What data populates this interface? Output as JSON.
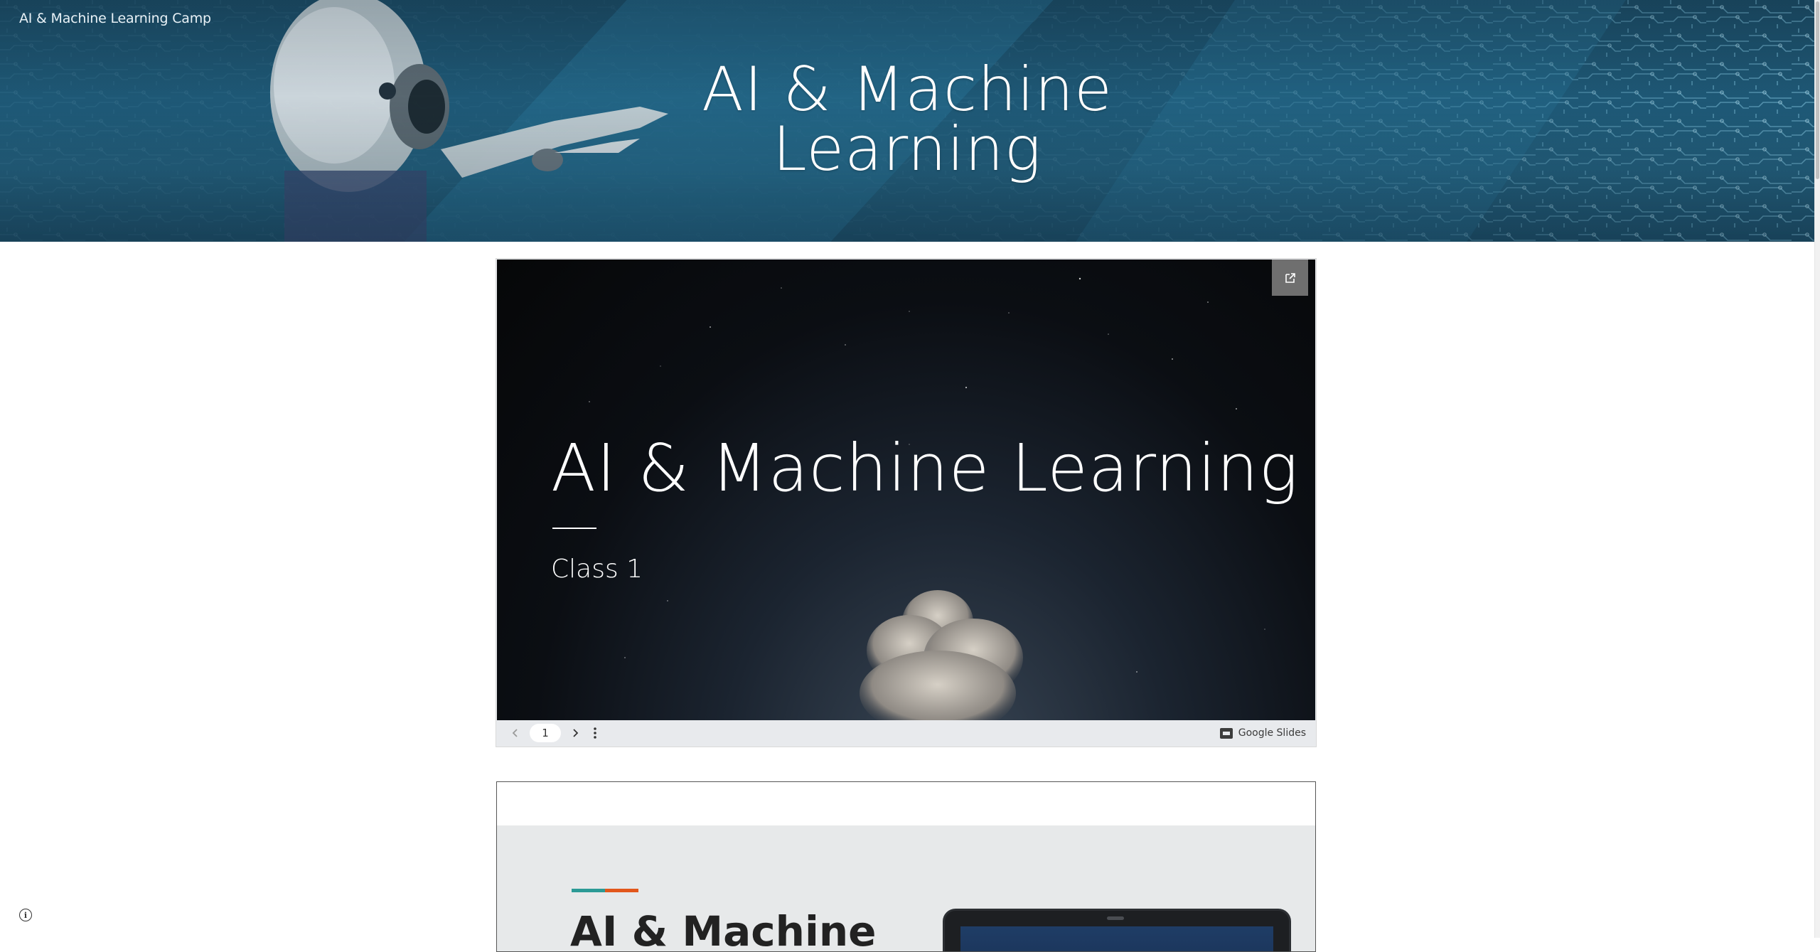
{
  "site": {
    "name": "AI & Machine Learning Camp"
  },
  "banner": {
    "title_line1": "AI & Machine",
    "title_line2": "Learning"
  },
  "slides_embed": {
    "slide_title": "AI & Machine Learning",
    "slide_subtitle": "Class 1",
    "current_page": "1",
    "brand_label": "Google Slides",
    "icons": {
      "popout": "open-in-new-icon",
      "prev": "chevron-left-icon",
      "next": "chevron-right-icon",
      "more": "more-vert-icon",
      "brand": "google-slides-icon"
    }
  },
  "second_embed": {
    "title": "AI & Machine",
    "accent_colors": [
      "#2c9a96",
      "#e2571c"
    ]
  },
  "footer": {
    "info_icon": "info-icon"
  },
  "colors": {
    "banner": "#1f5a78",
    "controls_bg": "#e8eaed"
  }
}
